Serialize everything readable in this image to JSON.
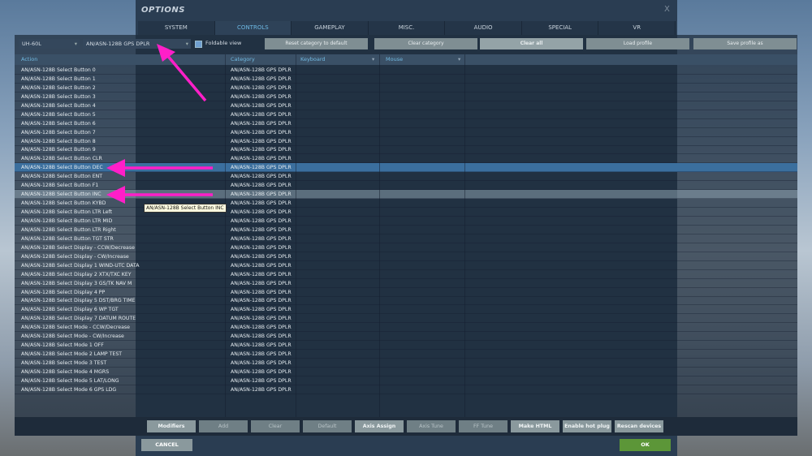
{
  "window": {
    "title": "OPTIONS",
    "close": "X"
  },
  "tabs": [
    "SYSTEM",
    "CONTROLS",
    "GAMEPLAY",
    "MISC.",
    "AUDIO",
    "SPECIAL",
    "VR"
  ],
  "active_tab": "CONTROLS",
  "toolbar": {
    "aircraft": "UH-60L",
    "category": "AN/ASN-128B GPS DPLR",
    "foldable": "Foldable view",
    "buttons": [
      "Reset category to default",
      "Clear category",
      "Clear all",
      "Load profile",
      "Save profile as"
    ]
  },
  "columns": {
    "action": "Action",
    "category": "Category",
    "keyboard": "Keyboard",
    "mouse": "Mouse"
  },
  "rows": [
    "AN/ASN-128B Select Button 0",
    "AN/ASN-128B Select Button 1",
    "AN/ASN-128B Select Button 2",
    "AN/ASN-128B Select Button 3",
    "AN/ASN-128B Select Button 4",
    "AN/ASN-128B Select Button 5",
    "AN/ASN-128B Select Button 6",
    "AN/ASN-128B Select Button 7",
    "AN/ASN-128B Select Button 8",
    "AN/ASN-128B Select Button 9",
    "AN/ASN-128B Select Button CLR",
    "AN/ASN-128B Select Button DEC",
    "AN/ASN-128B Select Button ENT",
    "AN/ASN-128B Select Button F1",
    "AN/ASN-128B Select Button INC",
    "AN/ASN-128B Select Button KYBD",
    "AN/ASN-128B Select Button LTR Left",
    "AN/ASN-128B Select Button LTR MID",
    "AN/ASN-128B Select Button LTR Right",
    "AN/ASN-128B Select Button TGT STR",
    "AN/ASN-128B Select Display - CCW/Decrease",
    "AN/ASN-128B Select Display - CW/Increase",
    "AN/ASN-128B Select Display 1 WIND-UTC DATA",
    "AN/ASN-128B Select Display 2 XTX/TXC KEY",
    "AN/ASN-128B Select Display 3 GS/TK NAV M",
    "AN/ASN-128B Select Display 4 PP",
    "AN/ASN-128B Select Display 5 DST/BRG TIME",
    "AN/ASN-128B Select Display 6 WP TGT",
    "AN/ASN-128B Select Display 7 DATUM ROUTE",
    "AN/ASN-128B Select Mode - CCW/Decrease",
    "AN/ASN-128B Select Mode - CW/Increase",
    "AN/ASN-128B Select Mode 1 OFF",
    "AN/ASN-128B Select Mode 2 LAMP TEST",
    "AN/ASN-128B Select Mode 3 TEST",
    "AN/ASN-128B Select Mode 4 MGRS",
    "AN/ASN-128B Select Mode 5 LAT/LONG",
    "AN/ASN-128B Select Mode 6 GPS LDG"
  ],
  "row_category": "AN/ASN-128B GPS DPLR",
  "selected_row": 11,
  "hover_row": 14,
  "tooltip": "AN/ASN-128B Select Button INC",
  "bottom_buttons": [
    "Modifiers",
    "Add",
    "Clear",
    "Default",
    "Axis Assign",
    "Axis Tune",
    "FF Tune",
    "Make HTML",
    "Enable hot plug",
    "Rescan devices"
  ],
  "disabled_buttons": [
    "Add",
    "Clear",
    "Default",
    "Axis Tune",
    "FF Tune"
  ],
  "cancel": "CANCEL",
  "ok": "OK",
  "colors": {
    "accent": "#6db8e3",
    "selected": "#3b6f9e",
    "ok": "#5c9638",
    "arrow": "#ff1fc8"
  }
}
